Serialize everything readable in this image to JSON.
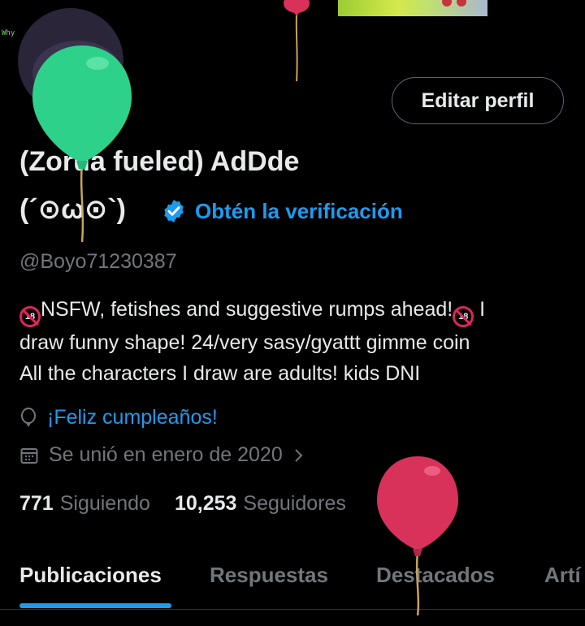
{
  "banner": {
    "avatar_text": "Why"
  },
  "profile": {
    "edit_button": "Editar perfil",
    "name_line1": "(Zorua fueled) AdDde",
    "name_line2": "(´⊙ω⊙`)",
    "verification_link": "Obtén la verificación",
    "handle": "@Boyo71230387",
    "bio": {
      "line1_text": "NSFW, fetishes and suggestive rumps ahead!",
      "line1_tail": "I",
      "line2": "draw funny shape! 24/very sasy/gyattt gimme coin",
      "line3": "All the characters I draw are adults! kids DNI"
    },
    "birthday_link": "¡Feliz cumpleaños!",
    "joined": "Se unió en enero de 2020",
    "following_count": "771",
    "following_label": "Siguiendo",
    "followers_count": "10,253",
    "followers_label": "Seguidores"
  },
  "tabs": [
    {
      "label": "Publicaciones",
      "active": true
    },
    {
      "label": "Respuestas",
      "active": false
    },
    {
      "label": "Destacados",
      "active": false
    },
    {
      "label": "Artí",
      "active": false
    }
  ],
  "colors": {
    "accent": "#1d9bf0",
    "secondary_text": "#71767b",
    "balloon_green": "#2ed18a",
    "balloon_red": "#d8325a"
  }
}
